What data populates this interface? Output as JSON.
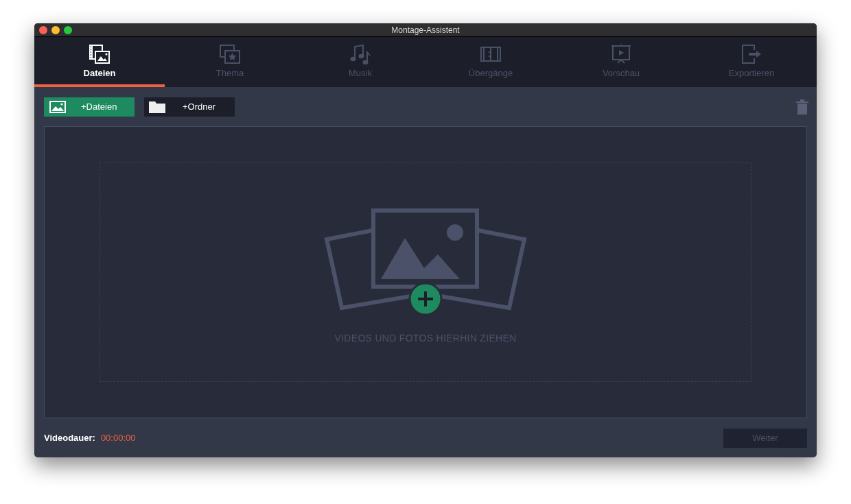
{
  "window": {
    "title": "Montage-Assistent"
  },
  "tabs": [
    {
      "label": "Dateien",
      "kind": "files",
      "selected": true
    },
    {
      "label": "Thema",
      "kind": "theme",
      "selected": false
    },
    {
      "label": "Musik",
      "kind": "music",
      "selected": false
    },
    {
      "label": "Übergänge",
      "kind": "transitions",
      "selected": false
    },
    {
      "label": "Vorschau",
      "kind": "preview",
      "selected": false
    },
    {
      "label": "Exportieren",
      "kind": "export",
      "selected": false
    }
  ],
  "toolbar": {
    "add_files": "+Dateien",
    "add_folder": "+Ordner"
  },
  "drop_zone": {
    "hint": "VIDEOS UND FOTOS HIERHIN ZIEHEN"
  },
  "footer": {
    "duration_label": "Videodauer:",
    "duration": "00:00:00",
    "next_button": {
      "label": "Weiter",
      "disabled": true
    }
  }
}
